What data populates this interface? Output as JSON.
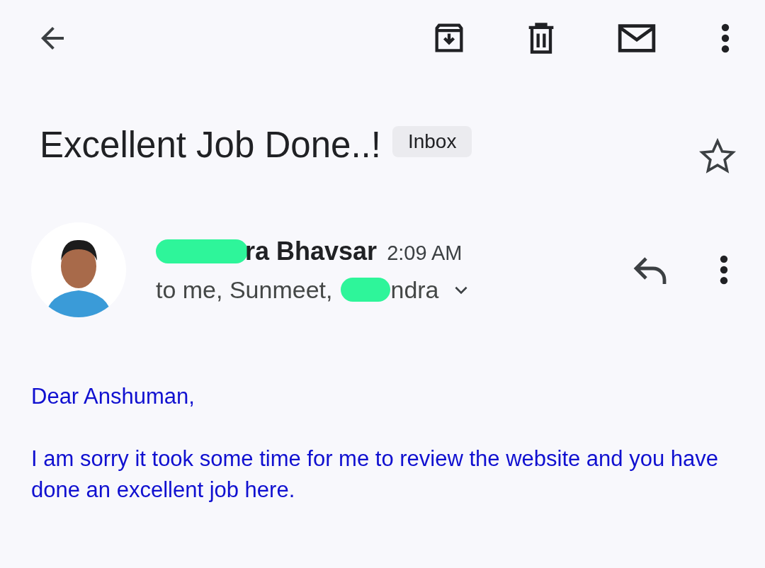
{
  "toolbar": {
    "actions": [
      {
        "kind": "back"
      },
      {
        "kind": "archive"
      },
      {
        "kind": "delete"
      },
      {
        "kind": "mail"
      },
      {
        "kind": "more"
      }
    ]
  },
  "subject": {
    "title": "Excellent Job Done..!",
    "label": "Inbox",
    "starred": false
  },
  "message": {
    "sender": "ra Bhavsar",
    "time": "2:09 AM",
    "recipients_before": "to me, Sunmeet,",
    "recipients_after": "ndra",
    "expanded": false,
    "body": [
      "Dear Anshuman,",
      "I am sorry it took some time for me to review the website and you have done an excellent job here."
    ]
  }
}
